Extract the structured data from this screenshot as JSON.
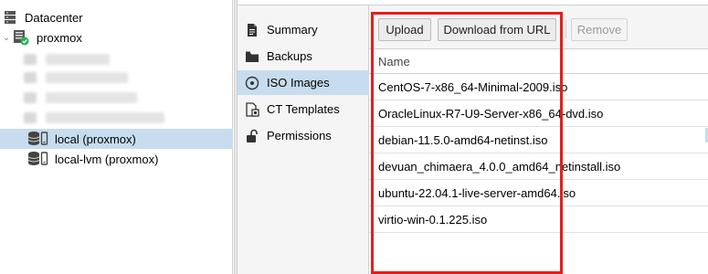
{
  "tree": {
    "datacenter_label": "Datacenter",
    "node_label": "proxmox",
    "storages": [
      {
        "label": "local (proxmox)",
        "selected": true
      },
      {
        "label": "local-lvm (proxmox)",
        "selected": false
      }
    ]
  },
  "subnav": {
    "items": [
      {
        "label": "Summary",
        "icon": "summary-icon",
        "active": false
      },
      {
        "label": "Backups",
        "icon": "backups-icon",
        "active": false
      },
      {
        "label": "ISO Images",
        "icon": "disc-icon",
        "active": true
      },
      {
        "label": "CT Templates",
        "icon": "ct-templates-icon",
        "active": false
      },
      {
        "label": "Permissions",
        "icon": "unlock-icon",
        "active": false
      }
    ]
  },
  "toolbar": {
    "upload_label": "Upload",
    "download_label": "Download from URL",
    "remove_label": "Remove"
  },
  "grid": {
    "column_name": "Name",
    "rows": [
      "CentOS-7-x86_64-Minimal-2009.iso",
      "OracleLinux-R7-U9-Server-x86_64-dvd.iso",
      "debian-11.5.0-amd64-netinst.iso",
      "devuan_chimaera_4.0.0_amd64_netinstall.iso",
      "ubuntu-22.04.1-live-server-amd64.iso",
      "virtio-win-0.1.225.iso"
    ]
  },
  "colors": {
    "selection": "#c7dcee",
    "highlight_box": "#e51e1e",
    "status_ok": "#21b24b"
  }
}
